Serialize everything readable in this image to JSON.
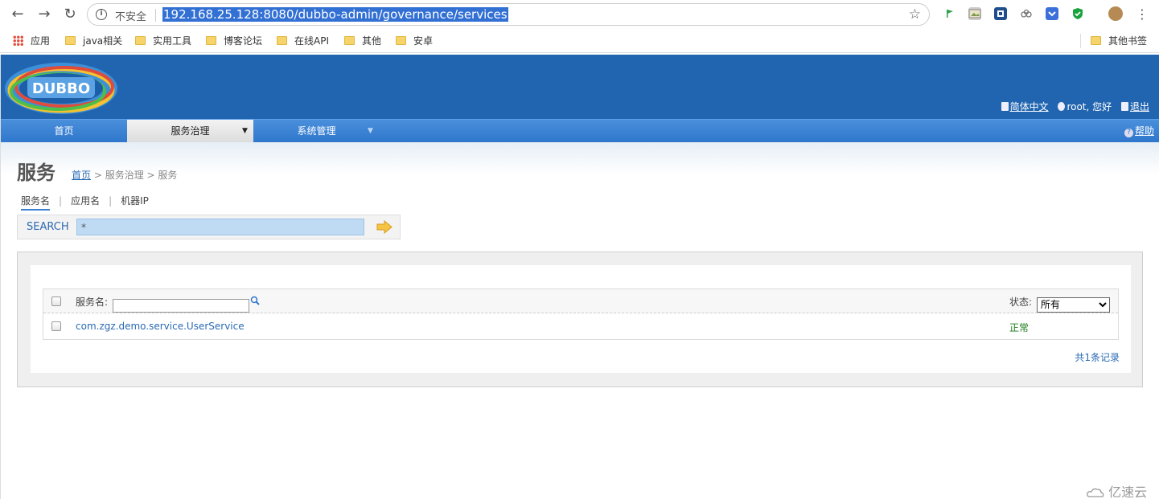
{
  "browser": {
    "insecure_label": "不安全",
    "url": "192.168.25.128:8080/dubbo-admin/governance/services",
    "bookmarks": [
      {
        "label": "应用"
      },
      {
        "label": "java相关"
      },
      {
        "label": "实用工具"
      },
      {
        "label": "博客论坛"
      },
      {
        "label": "在线API"
      },
      {
        "label": "其他"
      },
      {
        "label": "安卓"
      }
    ],
    "other_bookmarks": "其他书签"
  },
  "header": {
    "logo_text": "DUBBO",
    "lang_label": "简体中文",
    "user_label": "root, 您好",
    "logout_label": "退出"
  },
  "nav": {
    "items": [
      {
        "label": "首页"
      },
      {
        "label": "服务治理"
      },
      {
        "label": "系统管理"
      }
    ],
    "help_label": "帮助"
  },
  "page": {
    "title": "服务",
    "breadcrumb": {
      "home": "首页",
      "rest": " > 服务治理 > 服务"
    },
    "tabs": [
      {
        "label": "服务名"
      },
      {
        "label": "应用名"
      },
      {
        "label": "机器IP"
      }
    ],
    "search": {
      "label": "SEARCH",
      "value": "*"
    }
  },
  "table": {
    "filter_label": "服务名:",
    "filter_value": "",
    "status_label": "状态:",
    "status_selected": "所有",
    "rows": [
      {
        "service": "com.zgz.demo.service.UserService",
        "status": "正常"
      }
    ],
    "total_label": "共1条记录"
  },
  "watermark": "亿速云",
  "colors": {
    "header_blue": "#2165b0",
    "nav_blue": "#3a80d0",
    "link_blue": "#2a6ab5",
    "status_green": "#1e7c1e",
    "url_highlight": "#3370d4"
  }
}
